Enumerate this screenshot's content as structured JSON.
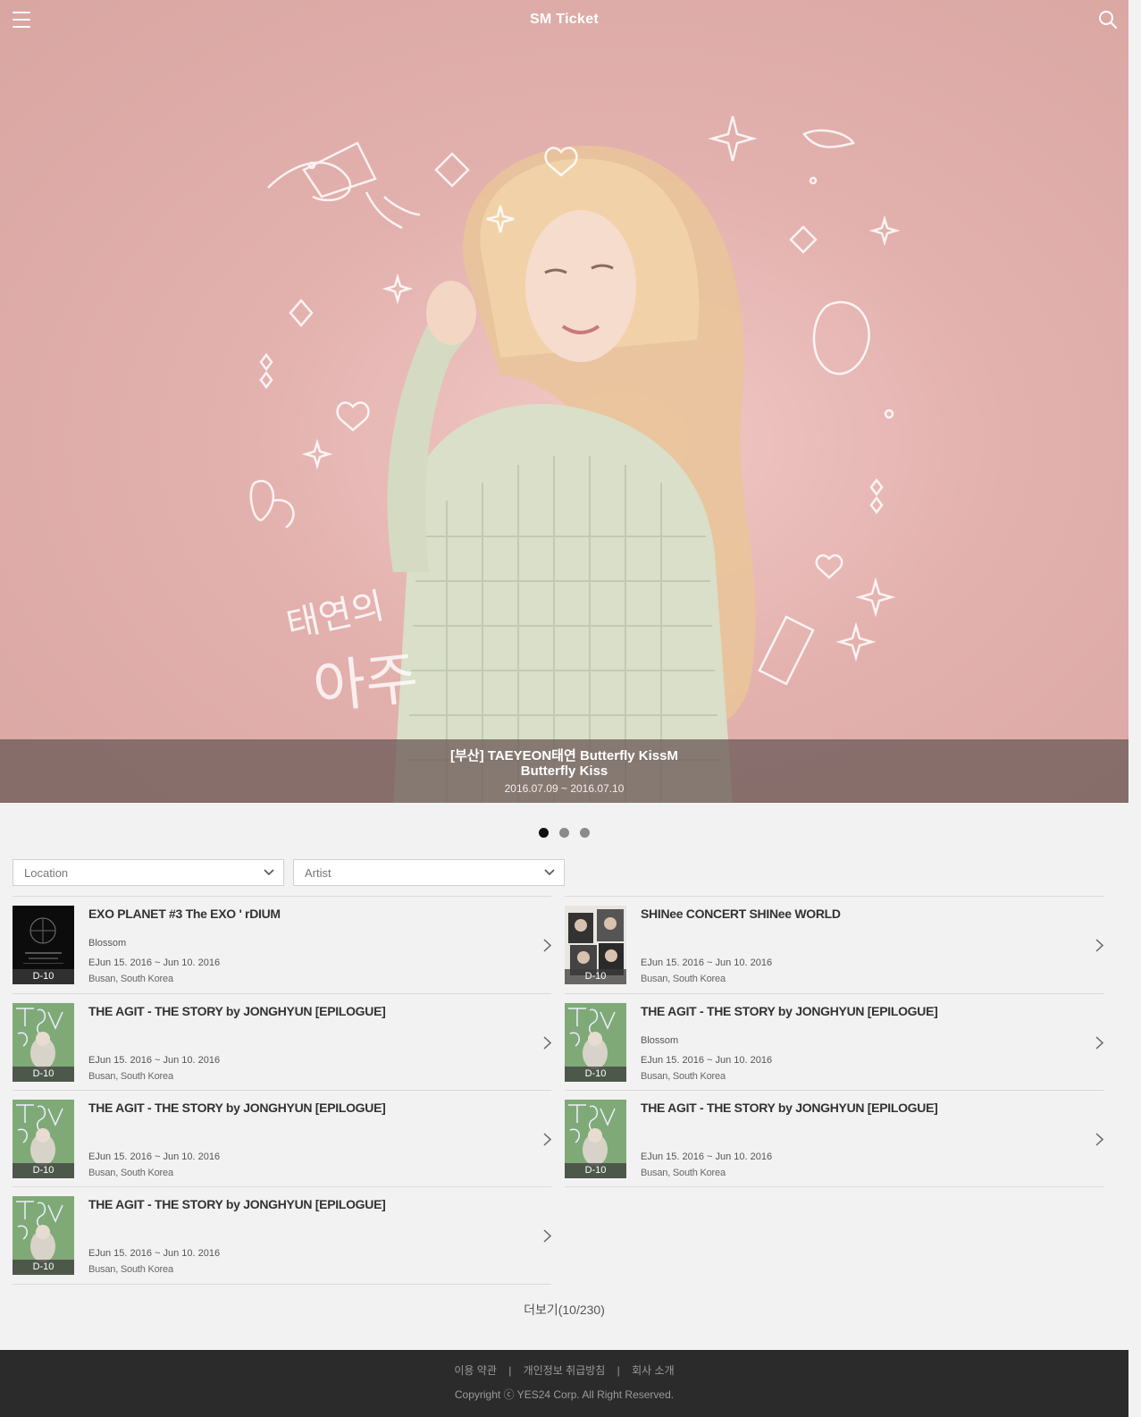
{
  "header": {
    "title": "SM Ticket",
    "menu_icon": "hamburger-menu-icon",
    "search_icon": "search-icon"
  },
  "hero": {
    "title_line1": "[부산] TAEYEON태연 Butterfly KissM",
    "title_line2": "Butterfly Kiss",
    "date_range": "2016.07.09 ~ 2016.07.10",
    "artwork_text_1": "태연의",
    "artwork_text_2": "아주",
    "slides_total": 3,
    "active_slide": 1
  },
  "filters": {
    "location": "Location",
    "artist": "Artist"
  },
  "events": [
    {
      "title": "EXO PLANET #3 The EXO ' rDIUM",
      "subtitle": "Blossom",
      "date": "EJun 15. 2016 ~ Jun 10. 2016",
      "location": "Busan, South Korea",
      "dday": "D-10",
      "thumb": "exo"
    },
    {
      "title": "SHINee CONCERT SHINee WORLD",
      "subtitle": "",
      "date": "EJun 15. 2016 ~ Jun 10. 2016",
      "location": "Busan, South Korea",
      "dday": "D-10",
      "thumb": "shinee"
    },
    {
      "title": "THE AGIT - THE STORY by JONGHYUN [EPILOGUE]",
      "subtitle": "",
      "date": "EJun 15. 2016 ~ Jun 10. 2016",
      "location": "Busan, South Korea",
      "dday": "D-10",
      "thumb": "agit"
    },
    {
      "title": "THE AGIT - THE STORY by JONGHYUN [EPILOGUE]",
      "subtitle": "Blossom",
      "date": "EJun 15. 2016 ~ Jun 10. 2016",
      "location": "Busan, South Korea",
      "dday": "D-10",
      "thumb": "agit"
    },
    {
      "title": "THE AGIT - THE STORY by JONGHYUN [EPILOGUE]",
      "subtitle": "",
      "date": "EJun 15. 2016 ~ Jun 10. 2016",
      "location": "Busan, South Korea",
      "dday": "D-10",
      "thumb": "agit"
    },
    {
      "title": "THE AGIT - THE STORY by JONGHYUN [EPILOGUE]",
      "subtitle": "",
      "date": "EJun 15. 2016 ~ Jun 10. 2016",
      "location": "Busan, South Korea",
      "dday": "D-10",
      "thumb": "agit"
    },
    {
      "title": "THE AGIT - THE STORY by JONGHYUN [EPILOGUE]",
      "subtitle": "",
      "date": "EJun 15. 2016 ~ Jun 10. 2016",
      "location": "Busan, South Korea",
      "dday": "D-10",
      "thumb": "agit"
    }
  ],
  "load_more": "더보기(10/230)",
  "footer": {
    "links": [
      "이용 약관",
      "개인정보 취급방침",
      "회사 소개"
    ],
    "copyright": "Copyright ⓒ YES24 Corp. All Right Reserved."
  },
  "colors": {
    "hero_bg": "#dcaaa6",
    "caption_bg": "#6e5c5a",
    "page_bg": "#f2f2f2",
    "footer_bg": "#2b2b2b"
  }
}
